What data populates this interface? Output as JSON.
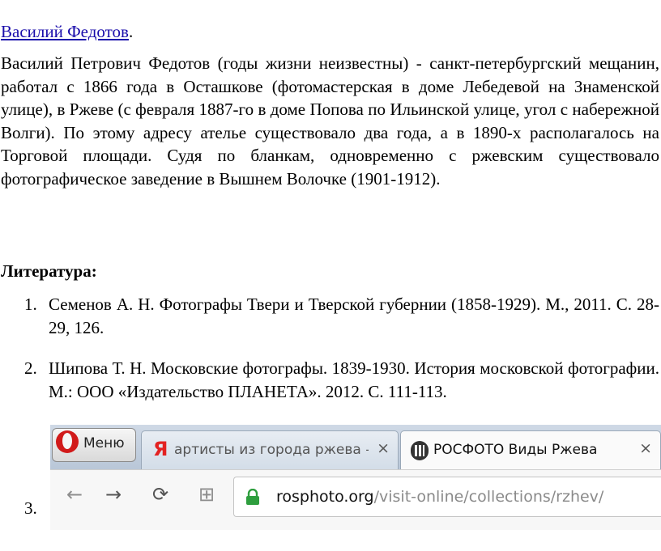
{
  "heading": {
    "link_text": "Василий Федотов",
    "trailing": "."
  },
  "bio": "Василий Петрович Федотов (годы жизни неизвестны) - санкт-петербургский мещанин, работал с 1866 года в Осташкове (фотомастерская в доме Лебедевой на Знаменской улице), в Ржеве (с февраля 1887-го в доме Попова по Ильинской улице, угол с набережной Волги). По этому адресу ателье существовало два года, а в 1890-х располагалось на Торговой площади. Судя по бланкам, одновременно с ржевским существовало фотографическое заведение в Вышнем Волочке (1901-1912).",
  "literature": {
    "title": "Литература:",
    "refs": [
      {
        "num": "1.",
        "text": "Семенов А. Н. Фотографы Твери и Тверской губернии (1858-1929). М., 2011. С. 28-29, 126."
      },
      {
        "num": "2.",
        "text": "Шипова Т. Н. Московские фотографы. 1839-1930. История московской фотографии. М.: ООО «Издательство ПЛАНЕТА». 2012. С. 111-113."
      },
      {
        "num": "3."
      }
    ]
  },
  "browser": {
    "menu_label": "Меню",
    "tabs": [
      {
        "icon": "Я",
        "title": "артисты из города ржева –",
        "close": "×"
      },
      {
        "title": "РОСФОТО Виды Ржева",
        "close": "×"
      }
    ],
    "toolbar": {
      "back": "←",
      "forward": "→",
      "reload": "⟳",
      "speed_dial": "⊞"
    },
    "url": {
      "host": "rosphoto.org",
      "path": "/visit-online/collections/rzhev/"
    },
    "colors": {
      "opera_red": "#d11a1a",
      "yandex_red": "#e32222",
      "secure_lock": "#2e9e3e",
      "link": "#1a0dab"
    }
  }
}
